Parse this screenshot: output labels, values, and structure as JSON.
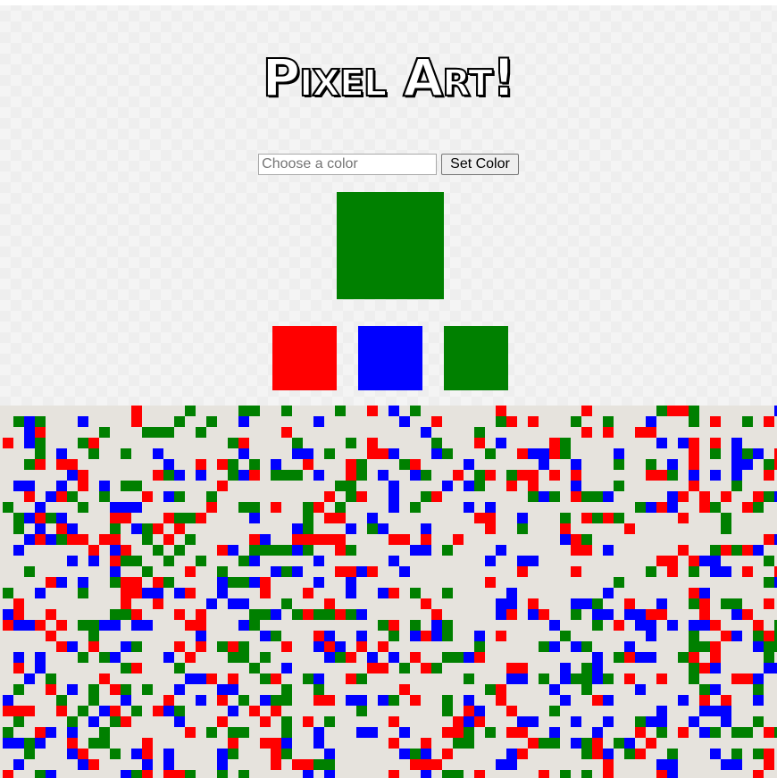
{
  "header": {
    "title": "Pixel Art!"
  },
  "controls": {
    "color_input_placeholder": "Choose a color",
    "color_input_value": "",
    "set_button_label": "Set Color"
  },
  "current_color": "#008000",
  "palette": [
    {
      "name": "red",
      "color": "#ff0000"
    },
    {
      "name": "blue",
      "color": "#0000ff"
    },
    {
      "name": "green",
      "color": "#008000"
    }
  ],
  "canvas": {
    "background": "#e6e3dd",
    "pixel_colors": [
      "#ff0000",
      "#0000ff",
      "#008000"
    ]
  }
}
